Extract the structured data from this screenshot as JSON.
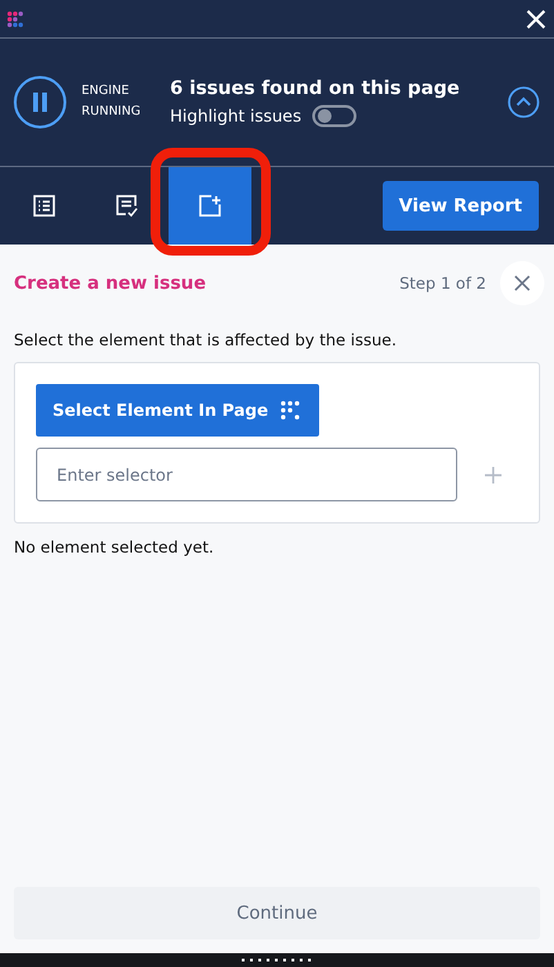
{
  "engine": {
    "status_lines": [
      "ENGINE",
      "RUNNING"
    ],
    "paused": false
  },
  "summary": {
    "title": "6 issues found on this page",
    "highlight_label": "Highlight issues",
    "highlight_on": false
  },
  "tabs": [
    {
      "kind": "list",
      "selected": false
    },
    {
      "kind": "checklist",
      "selected": false
    },
    {
      "kind": "new-issue",
      "selected": true
    }
  ],
  "report_button": "View Report",
  "panel": {
    "title": "Create a new issue",
    "step": "Step 1 of 2",
    "instruction": "Select the element that is affected by the issue.",
    "select_button": "Select Element In Page",
    "selector": {
      "placeholder": "Enter selector"
    },
    "status": "No element selected yet."
  },
  "continue_button": {
    "label": "Continue",
    "disabled": true
  }
}
